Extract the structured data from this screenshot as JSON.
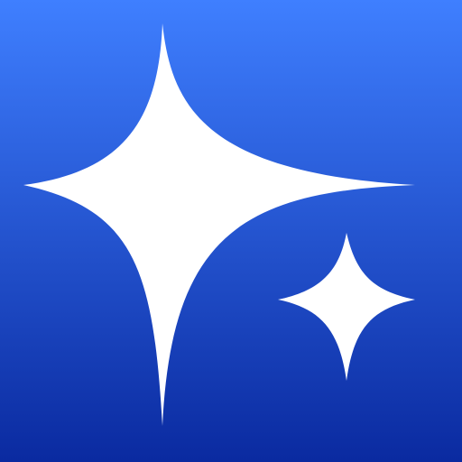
{
  "icon": {
    "name": "sparkles-icon",
    "colors": {
      "gradient_top": "#3f7fff",
      "gradient_bottom": "#0a2aa0",
      "foreground": "#ffffff"
    }
  }
}
